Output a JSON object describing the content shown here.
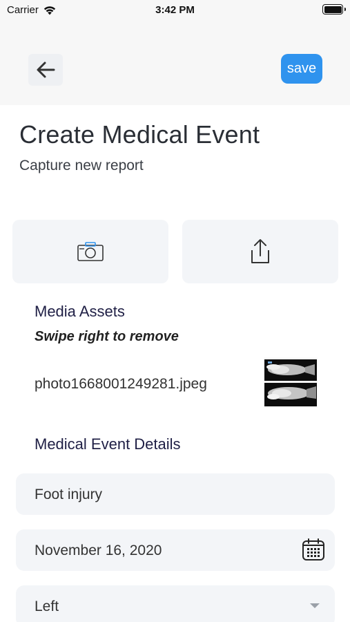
{
  "status_bar": {
    "carrier": "Carrier",
    "time": "3:42 PM"
  },
  "nav": {
    "back_icon": "arrow-left-icon",
    "save_label": "save",
    "accent_color": "#2f93ee"
  },
  "header": {
    "title": "Create Medical Event",
    "subtitle": "Capture new report"
  },
  "actions": {
    "camera_icon": "camera-icon",
    "share_icon": "share-upload-icon"
  },
  "media": {
    "heading": "Media Assets",
    "hint": "Swipe right to remove",
    "items": [
      {
        "filename": "photo1668001249281.jpeg",
        "thumbnail": "x-ray-foot-image"
      }
    ]
  },
  "details": {
    "heading": "Medical Event Details",
    "title_value": "Foot injury",
    "date_value": "November 16, 2020",
    "side_value": "Left"
  }
}
